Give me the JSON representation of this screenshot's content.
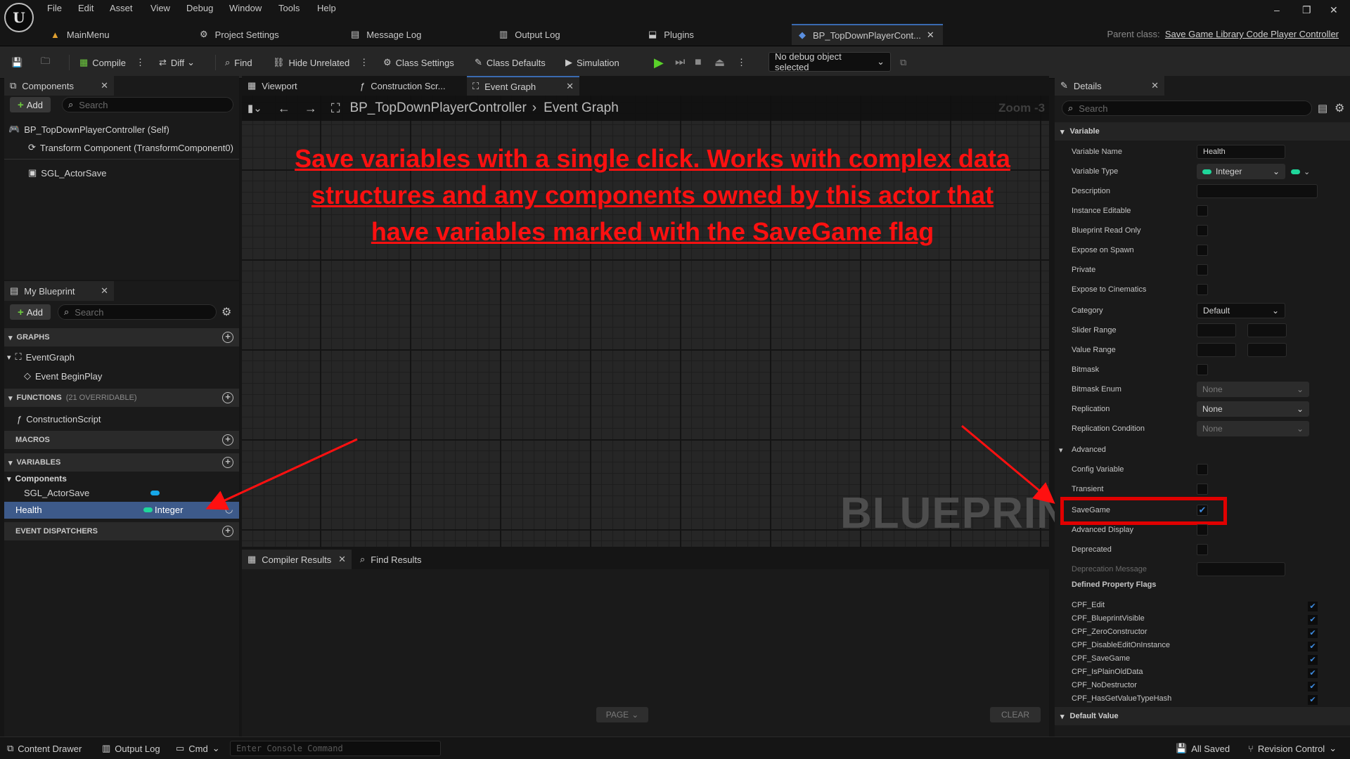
{
  "menu": [
    "File",
    "Edit",
    "Asset",
    "View",
    "Debug",
    "Window",
    "Tools",
    "Help"
  ],
  "doc_tabs": [
    {
      "label": "MainMenu",
      "icon": "▲"
    },
    {
      "label": "Project Settings",
      "icon": "⚙"
    },
    {
      "label": "Message Log",
      "icon": "▤"
    },
    {
      "label": "Output Log",
      "icon": "▥"
    },
    {
      "label": "Plugins",
      "icon": "⬓"
    },
    {
      "label": "BP_TopDownPlayerCont...",
      "icon": "🎮"
    }
  ],
  "parent_class": {
    "prefix": "Parent class:",
    "value": "Save Game Library Code Player Controller"
  },
  "toolbar": {
    "compile": "Compile",
    "diff": "Diff",
    "find": "Find",
    "hide_unrelated": "Hide Unrelated",
    "class_settings": "Class Settings",
    "class_defaults": "Class Defaults",
    "simulation": "Simulation",
    "debug_object": "No debug object selected"
  },
  "components_panel": {
    "title": "Components",
    "add": "Add",
    "search_placeholder": "Search",
    "items": [
      "BP_TopDownPlayerController (Self)",
      "Transform Component (TransformComponent0)",
      "SGL_ActorSave"
    ]
  },
  "my_blueprint": {
    "title": "My Blueprint",
    "add": "Add",
    "search_placeholder": "Search",
    "graphs_header": "GRAPHS",
    "event_graph": "EventGraph",
    "event_begin_play": "Event BeginPlay",
    "functions_header": "FUNCTIONS",
    "functions_note": "(21 OVERRIDABLE)",
    "construction_script": "ConstructionScript",
    "macros_header": "MACROS",
    "variables_header": "VARIABLES",
    "components_group": "Components",
    "var_actor_save": "SGL_ActorSave",
    "var_health": "Health",
    "var_health_type": "Integer",
    "dispatchers_header": "EVENT DISPATCHERS"
  },
  "editor_tabs": [
    "Viewport",
    "Construction Scr...",
    "Event Graph"
  ],
  "graph": {
    "breadcrumb_bp": "BP_TopDownPlayerController",
    "breadcrumb_graph": "Event Graph",
    "zoom": "Zoom -3",
    "watermark": "BLUEPRINT",
    "annotation_lines": [
      "Save variables with a single click. Works with complex data",
      "structures and any components owned by this actor that",
      "have variables marked with the SaveGame flag"
    ]
  },
  "bottom": {
    "compiler_results": "Compiler Results",
    "find_results": "Find Results",
    "page": "PAGE",
    "clear": "CLEAR"
  },
  "details": {
    "title": "Details",
    "search_placeholder": "Search",
    "variable_section": "Variable",
    "variable_name_label": "Variable Name",
    "variable_name": "Health",
    "variable_type_label": "Variable Type",
    "variable_type": "Integer",
    "description_label": "Description",
    "instance_editable": "Instance Editable",
    "blueprint_read_only": "Blueprint Read Only",
    "expose_on_spawn": "Expose on Spawn",
    "private": "Private",
    "expose_to_cinematics": "Expose to Cinematics",
    "category_label": "Category",
    "category": "Default",
    "slider_range": "Slider Range",
    "value_range": "Value Range",
    "bitmask": "Bitmask",
    "bitmask_enum_label": "Bitmask Enum",
    "bitmask_enum": "None",
    "replication_label": "Replication",
    "replication": "None",
    "replication_condition_label": "Replication Condition",
    "replication_condition": "None",
    "advanced_section": "Advanced",
    "config_variable": "Config Variable",
    "transient": "Transient",
    "savegame": "SaveGame",
    "advanced_display": "Advanced Display",
    "deprecated": "Deprecated",
    "deprecation_message": "Deprecation Message",
    "defined_flags_label": "Defined Property Flags",
    "flags": [
      "CPF_Edit",
      "CPF_BlueprintVisible",
      "CPF_ZeroConstructor",
      "CPF_DisableEditOnInstance",
      "CPF_SaveGame",
      "CPF_IsPlainOldData",
      "CPF_NoDestructor",
      "CPF_HasGetValueTypeHash"
    ],
    "default_value_section": "Default Value",
    "highlight_color": "#e00000"
  },
  "statusbar": {
    "content_drawer": "Content Drawer",
    "output_log": "Output Log",
    "cmd": "Cmd",
    "console_placeholder": "Enter Console Command",
    "all_saved": "All Saved",
    "revision_control": "Revision Control"
  },
  "colors": {
    "accent": "#3a6ab0",
    "integer_pin": "#1fd69a",
    "component_pin": "#16a7e8",
    "annotation": "#ff1010",
    "play": "#5ad12a"
  }
}
